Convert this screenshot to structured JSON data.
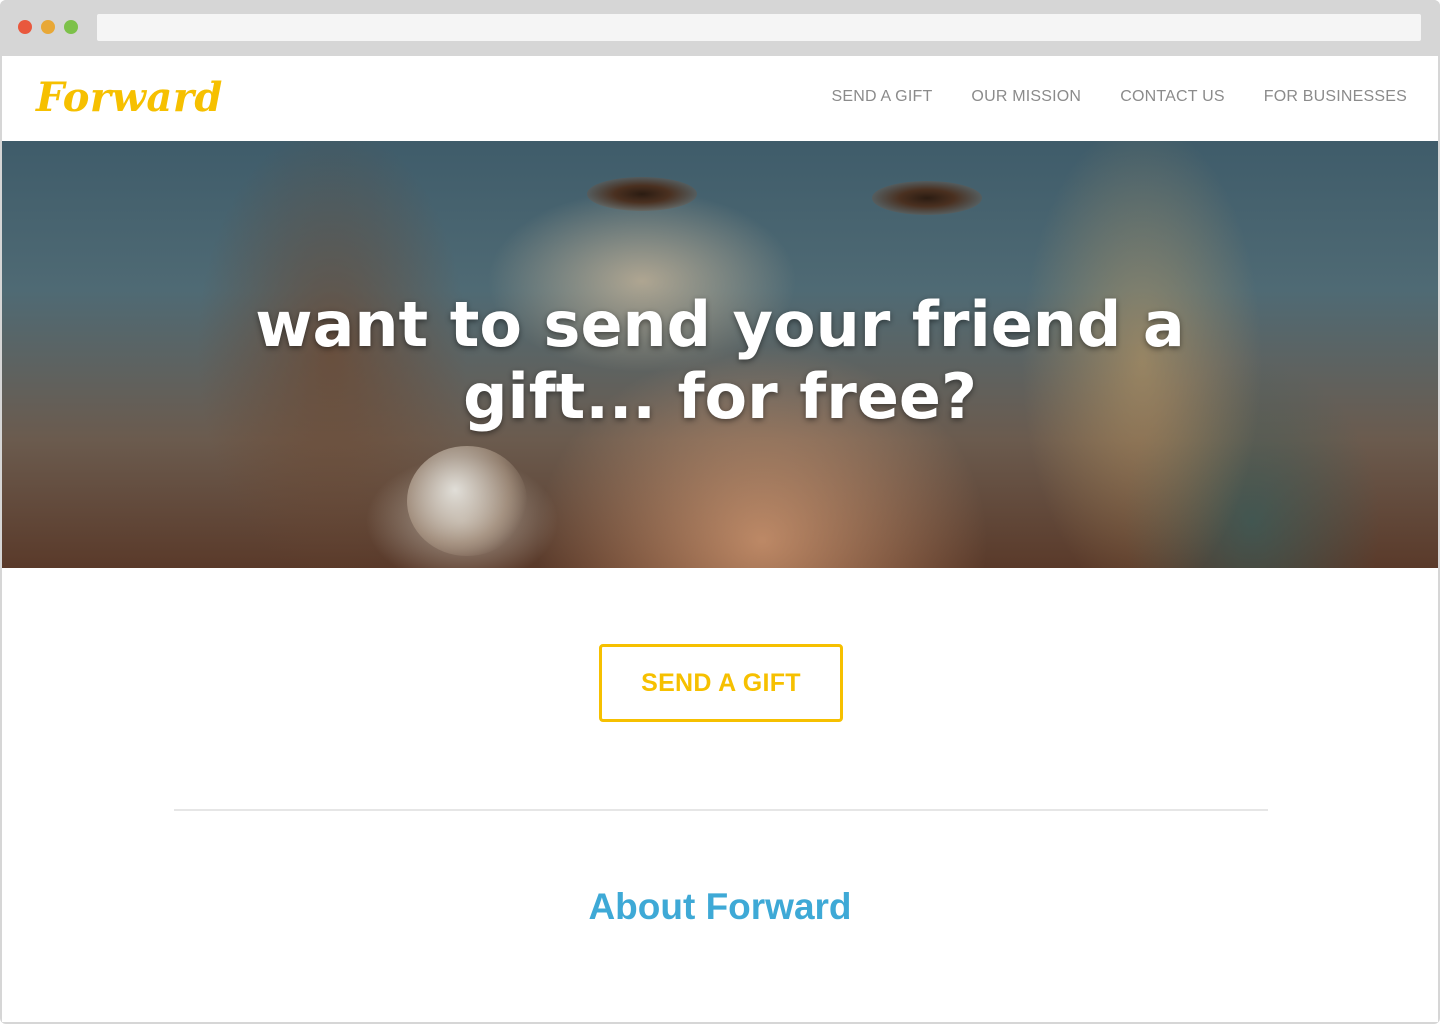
{
  "site": {
    "logo": "Forward"
  },
  "nav": {
    "items": [
      {
        "label": "SEND A GIFT"
      },
      {
        "label": "OUR MISSION"
      },
      {
        "label": "CONTACT US"
      },
      {
        "label": "FOR BUSINESSES"
      }
    ]
  },
  "hero": {
    "headline": "want to send your friend a gift... for free?"
  },
  "cta": {
    "label": "SEND A GIFT"
  },
  "about": {
    "heading": "About Forward"
  },
  "colors": {
    "brand_yellow": "#f6c000",
    "link_blue": "#3ea9d6",
    "nav_gray": "#8b8b8b"
  }
}
